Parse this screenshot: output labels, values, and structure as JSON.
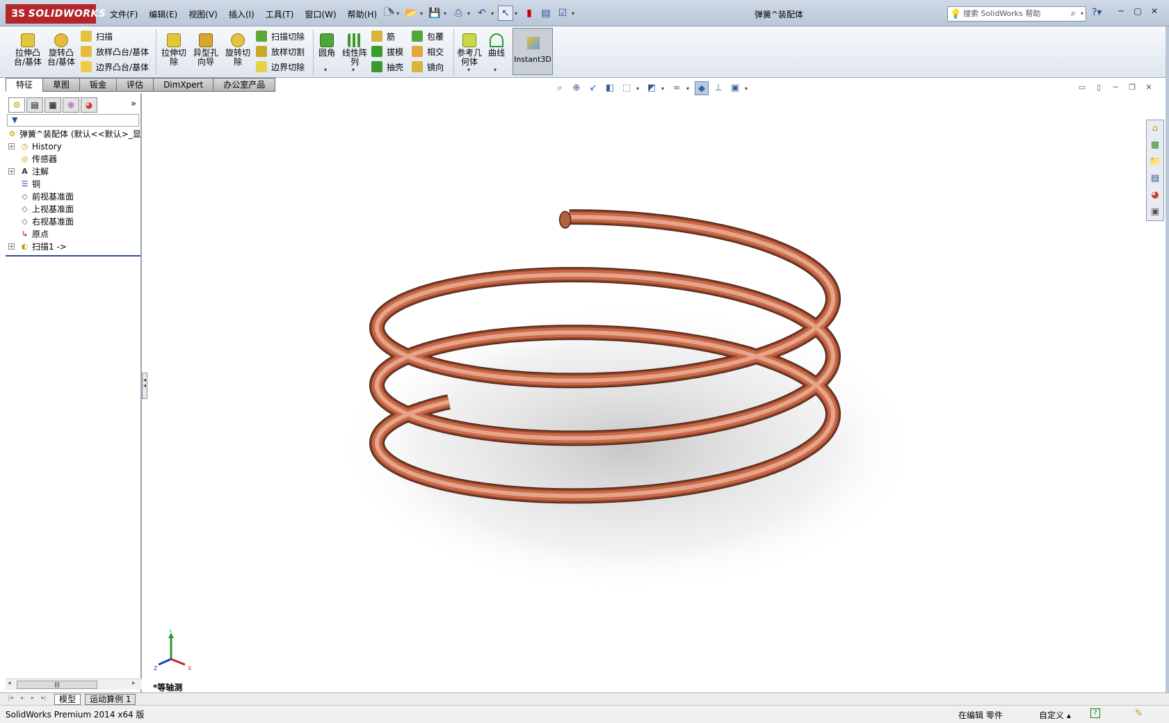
{
  "app": {
    "logo_text": "SOLIDWORKS",
    "logo_mark": "ƎS",
    "doc_title": "弹簧^装配体",
    "menus": [
      "文件(F)",
      "编辑(E)",
      "视图(V)",
      "插入(I)",
      "工具(T)",
      "窗口(W)",
      "帮助(H)"
    ],
    "search_placeholder": "搜索 SolidWorks 帮助"
  },
  "command_manager": {
    "big_buttons": [
      {
        "label": "拉伸凸\n台/基体"
      },
      {
        "label": "旋转凸\n台/基体"
      },
      {
        "label": "拉伸切\n除"
      },
      {
        "label": "异型孔\n向导"
      },
      {
        "label": "旋转切\n除"
      },
      {
        "label": "圆角"
      },
      {
        "label": "线性阵\n列"
      },
      {
        "label": "参考几\n何体"
      },
      {
        "label": "曲线"
      }
    ],
    "small_buttons": [
      "扫描",
      "放样凸台/基体",
      "边界凸台/基体",
      "扫描切除",
      "放样切割",
      "边界切除",
      "筋",
      "拔模",
      "抽壳",
      "包覆",
      "相交",
      "镜向"
    ],
    "instant3d": "Instant3D"
  },
  "tabs": [
    "特征",
    "草图",
    "钣金",
    "评估",
    "DimXpert",
    "办公室产品"
  ],
  "active_tab": 0,
  "feature_tree": {
    "root": "弹簧^装配体 (默认<<默认>_显",
    "items": [
      "History",
      "传感器",
      "注解",
      "铜",
      "前视基准面",
      "上视基准面",
      "右视基准面",
      "原点",
      "扫描1 ->"
    ]
  },
  "viewport": {
    "view_label": "*等轴测",
    "triad_axes": [
      "Y",
      "Z",
      "X"
    ],
    "spring_color": "#c8694a"
  },
  "model_tabs": [
    "模型",
    "运动算例 1"
  ],
  "status": {
    "product": "SolidWorks Premium 2014 x64 版",
    "edit_mode": "在编辑 零件",
    "custom": "自定义",
    "help": "?"
  }
}
